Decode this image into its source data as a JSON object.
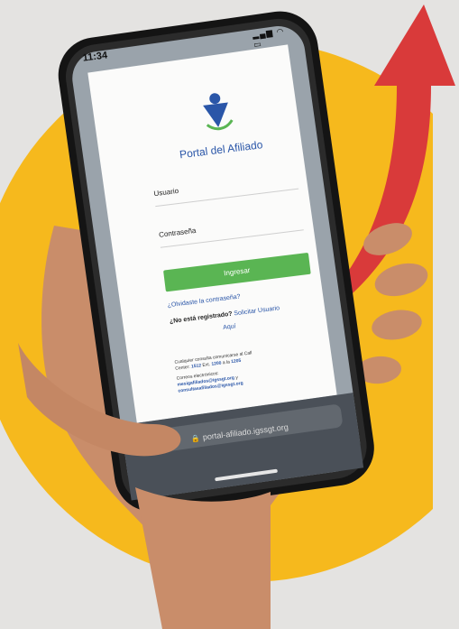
{
  "status_bar": {
    "time": "11:34",
    "icons": "5G wifi battery"
  },
  "colors": {
    "background": "#e4e3e1",
    "circle": "#f6b91d",
    "arrow": "#d93a3a",
    "button": "#5ab553",
    "link": "#2a56a8",
    "phone_body": "#141414"
  },
  "login": {
    "logo_icon": "person-logo-icon",
    "title": "Portal del Afiliado",
    "username_label": "Usuario",
    "password_label": "Contraseña",
    "submit_label": "Ingresar",
    "forgot_link": "¿Olvidaste la contraseña?",
    "register_question": "¿No está registrado?",
    "register_link": "Solicitar Usuario",
    "register_aqui": "Aquí",
    "info_line1": "Cualquier consulta comunicarse al Call",
    "info_line2_prefix": "Center:",
    "info_line2_number1": "1512",
    "info_line2_mid": "Ext.",
    "info_line2_number2": "1200",
    "info_line2_sep": "a la",
    "info_line2_number3": "1205",
    "info_line3": "Correos electrónicos:",
    "email1": "mesigafiliados@igssgt.org",
    "email_sep": "y",
    "email2": "consultasafiliados@igssgt.org"
  },
  "browser": {
    "url": "portal-afiliado.igssgt.org",
    "lock_icon": "lock-icon",
    "reload_icon": "reload-icon",
    "tab_icon": "tab-icon",
    "share_icon": "share-icon",
    "bookmarks_icon": "bookmarks-icon",
    "tabs_icon": "tabs-icon",
    "back_icon": "back-icon",
    "forward_icon": "forward-icon"
  }
}
